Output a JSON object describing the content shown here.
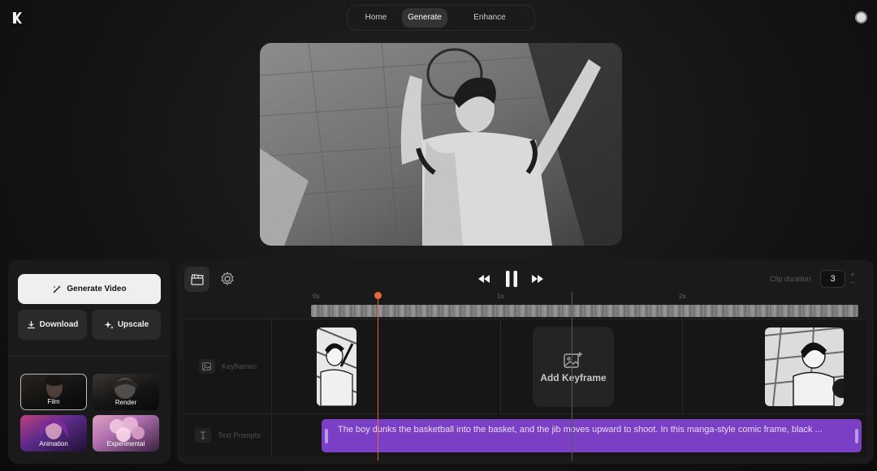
{
  "topnav": {
    "tabs": [
      {
        "label": "Home"
      },
      {
        "label": "Generate"
      },
      {
        "label": "Enhance"
      }
    ],
    "active_tab": "Generate"
  },
  "left_panel": {
    "generate_label": "Generate Video",
    "download_label": "Download",
    "upscale_label": "Upscale",
    "styles": [
      {
        "label": "Film",
        "selected": true
      },
      {
        "label": "Render"
      },
      {
        "label": "Animation"
      },
      {
        "label": "Experimental"
      }
    ]
  },
  "timeline": {
    "clip_duration_label": "Clip duration",
    "clip_duration_value": "3",
    "plus": "+",
    "minus": "−",
    "ruler": [
      "0s",
      "1s",
      "2s"
    ],
    "tracks": {
      "keyframes_label": "Keyframes",
      "text_prompts_label": "Text Prompts"
    },
    "add_keyframe_label": "Add Keyframe",
    "prompt_text": "The boy dunks the basketball into the basket, and the jib moves upward to shoot. In this manga-style comic frame, black ...",
    "playhead_seconds": 0.35,
    "prompt_color": "#7a3fc4",
    "playhead_color": "#e0623a"
  },
  "icons": {
    "logo": "logo-icon",
    "avatar": "avatar-icon",
    "generate": "magic-wand-icon",
    "download": "download-icon",
    "upscale": "sparkle-icon",
    "clapper": "clapperboard-icon",
    "settings": "gear-icon",
    "rewind": "rewind-icon",
    "pause": "pause-icon",
    "fast_forward": "fast-forward-icon",
    "image": "image-icon",
    "text": "text-cursor-icon",
    "add_image": "add-image-icon"
  }
}
